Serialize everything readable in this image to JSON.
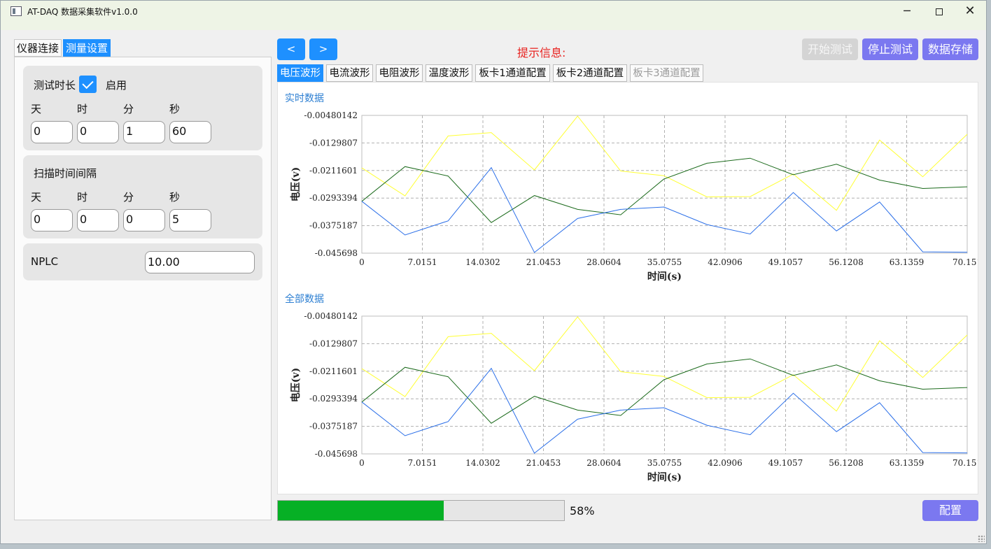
{
  "window": {
    "title": "AT-DAQ 数据采集软件v1.0.0",
    "min": "─",
    "close": "✕"
  },
  "left_tabs": [
    "仪器连接",
    "测量设置"
  ],
  "duration": {
    "label": "测试时长",
    "enable_label": "启用",
    "enabled": true,
    "units": [
      "天",
      "时",
      "分",
      "秒"
    ],
    "values": [
      "0",
      "0",
      "1",
      "60"
    ]
  },
  "interval": {
    "label": "扫描时间间隔",
    "units": [
      "天",
      "时",
      "分",
      "秒"
    ],
    "values": [
      "0",
      "0",
      "0",
      "5"
    ]
  },
  "nplc": {
    "label": "NPLC",
    "value": "10.00"
  },
  "nav": {
    "prev": "<",
    "next": ">"
  },
  "hint": "提示信息:",
  "actions": {
    "start": "开始测试",
    "stop": "停止测试",
    "save": "数据存储",
    "config": "配置"
  },
  "chart_tabs": [
    "电压波形",
    "电流波形",
    "电阻波形",
    "温度波形",
    "板卡1通道配置",
    "板卡2通道配置",
    "板卡3通道配置"
  ],
  "progress": {
    "percent": 58,
    "text": "58%"
  },
  "colors": {
    "accent": "#1e90ff",
    "action": "#7b78f0",
    "progress": "#06b025",
    "hint": "#e8211e"
  },
  "chart_data": [
    {
      "type": "line",
      "title": "实时数据",
      "xlabel": "时间(s)",
      "ylabel": "电压(v)",
      "xticks": [
        "0",
        "7.0151",
        "14.0302",
        "21.0453",
        "28.0604",
        "35.0755",
        "42.0906",
        "49.1057",
        "56.1208",
        "63.1359",
        "70.151"
      ],
      "yticks": [
        "-0.00480142",
        "-0.0129807",
        "-0.0211601",
        "-0.0293394",
        "-0.0375187",
        "-0.045698"
      ],
      "xlim": [
        0,
        70.151
      ],
      "ylim": [
        -0.045698,
        -0.00480142
      ],
      "grid": true,
      "x": [
        0,
        5,
        10,
        15,
        20,
        25,
        30,
        35,
        40,
        45,
        50,
        55,
        60,
        65,
        70.151
      ],
      "series": [
        {
          "color": "#ffff33",
          "values": [
            -0.0204,
            -0.0287,
            -0.0109,
            -0.0099,
            -0.021,
            -0.005,
            -0.0213,
            -0.0227,
            -0.029,
            -0.0289,
            -0.0222,
            -0.033,
            -0.0121,
            -0.023,
            -0.0104
          ]
        },
        {
          "color": "#1b6a1b",
          "values": [
            -0.0303,
            -0.02,
            -0.0228,
            -0.0366,
            -0.0286,
            -0.0327,
            -0.0343,
            -0.0237,
            -0.019,
            -0.0175,
            -0.0224,
            -0.0193,
            -0.024,
            -0.0265,
            -0.026
          ]
        },
        {
          "color": "#2b6fe8",
          "values": [
            -0.0303,
            -0.0403,
            -0.0361,
            -0.0203,
            -0.0455,
            -0.0354,
            -0.0327,
            -0.032,
            -0.0372,
            -0.04,
            -0.0277,
            -0.0391,
            -0.0305,
            -0.0453,
            -0.0454
          ]
        }
      ]
    },
    {
      "type": "line",
      "title": "全部数据",
      "xlabel": "时间(s)",
      "ylabel": "电压(v)",
      "xticks": [
        "0",
        "7.0151",
        "14.0302",
        "21.0453",
        "28.0604",
        "35.0755",
        "42.0906",
        "49.1057",
        "56.1208",
        "63.1359",
        "70.151"
      ],
      "yticks": [
        "-0.00480142",
        "-0.0129807",
        "-0.0211601",
        "-0.0293394",
        "-0.0375187",
        "-0.045698"
      ],
      "xlim": [
        0,
        70.151
      ],
      "ylim": [
        -0.045698,
        -0.00480142
      ],
      "grid": true,
      "x": [
        0,
        5,
        10,
        15,
        20,
        25,
        30,
        35,
        40,
        45,
        50,
        55,
        60,
        65,
        70.151
      ],
      "series": [
        {
          "color": "#ffff33",
          "values": [
            -0.0204,
            -0.0287,
            -0.0109,
            -0.0099,
            -0.021,
            -0.005,
            -0.0213,
            -0.0227,
            -0.029,
            -0.0289,
            -0.0222,
            -0.033,
            -0.0121,
            -0.023,
            -0.0104
          ]
        },
        {
          "color": "#1b6a1b",
          "values": [
            -0.0303,
            -0.02,
            -0.0228,
            -0.0366,
            -0.0286,
            -0.0327,
            -0.0343,
            -0.0237,
            -0.019,
            -0.0175,
            -0.0224,
            -0.0193,
            -0.024,
            -0.0265,
            -0.026
          ]
        },
        {
          "color": "#2b6fe8",
          "values": [
            -0.0303,
            -0.0403,
            -0.0361,
            -0.0203,
            -0.0455,
            -0.0354,
            -0.0327,
            -0.032,
            -0.0372,
            -0.04,
            -0.0277,
            -0.0391,
            -0.0305,
            -0.0453,
            -0.0454
          ]
        }
      ]
    }
  ]
}
